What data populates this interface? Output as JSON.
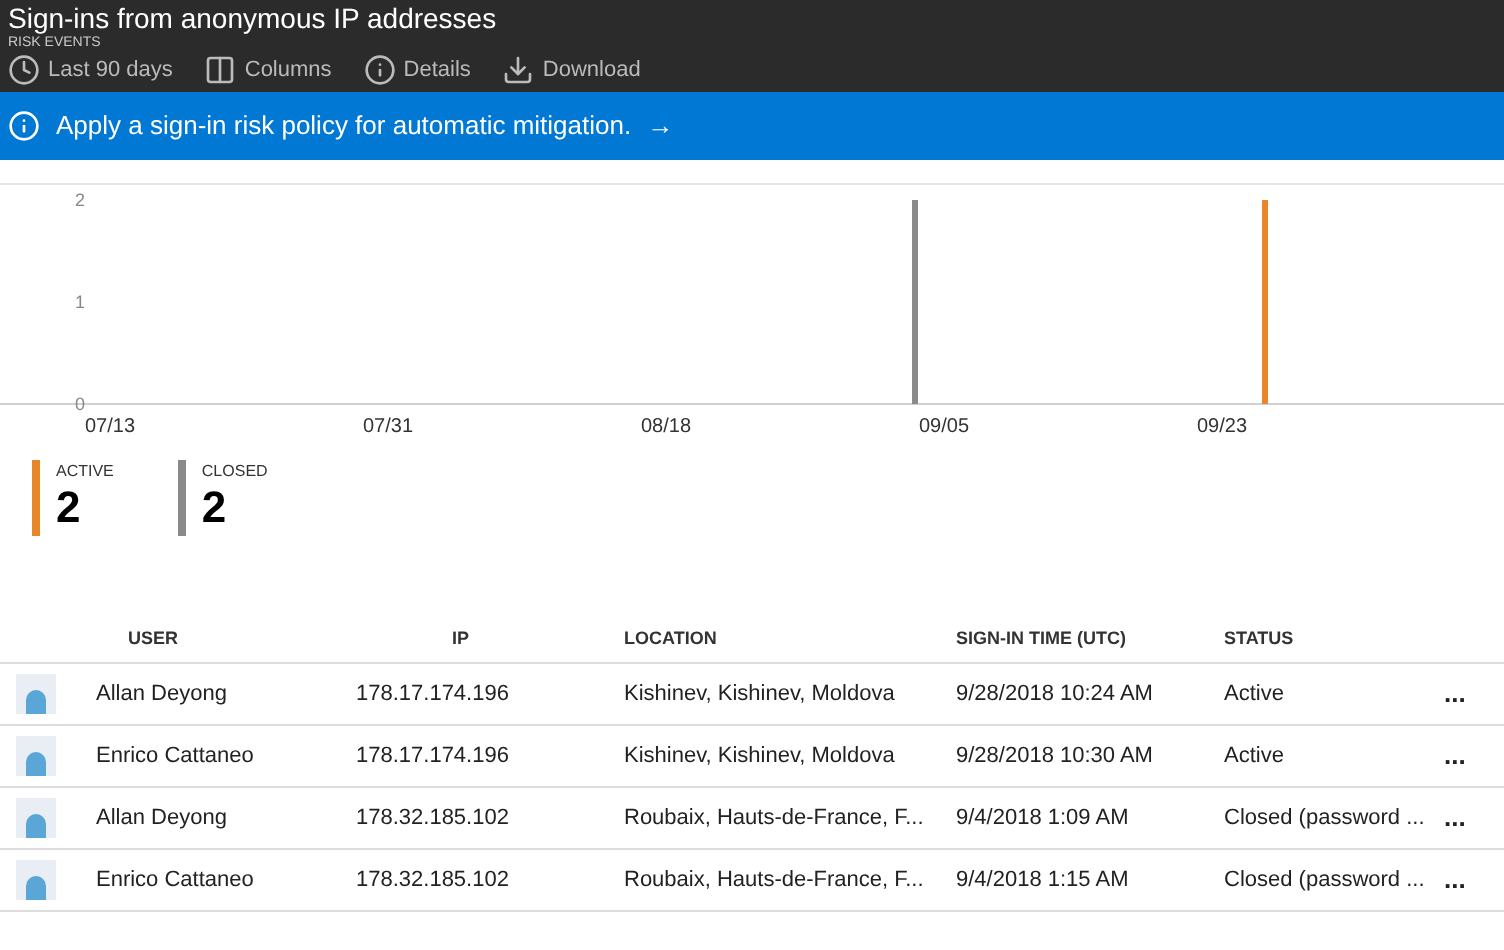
{
  "header": {
    "title": "Sign-ins from anonymous IP addresses",
    "subtitle": "RISK EVENTS"
  },
  "toolbar": [
    {
      "kind": "clock",
      "label": "Last 90 days"
    },
    {
      "kind": "columns",
      "label": "Columns"
    },
    {
      "kind": "info",
      "label": "Details"
    },
    {
      "kind": "download",
      "label": "Download"
    }
  ],
  "banner": {
    "text": "Apply a sign-in risk policy for automatic mitigation.",
    "arrow": "→"
  },
  "chart": {
    "chart_data": {
      "type": "bar",
      "categories": [
        "07/13",
        "07/31",
        "08/18",
        "09/05",
        "09/23"
      ],
      "series": [
        {
          "name": "ACTIVE",
          "color": "#e8872a",
          "values": [
            null,
            null,
            null,
            null,
            2
          ]
        },
        {
          "name": "CLOSED",
          "color": "#8a8a8a",
          "values": [
            null,
            null,
            null,
            2,
            null
          ]
        }
      ],
      "ylim": [
        0,
        2
      ],
      "yticks": [
        0,
        1,
        2
      ]
    }
  },
  "legend": [
    {
      "count": "2"
    },
    {
      "count": "2"
    }
  ],
  "table": {
    "columns": [
      "USER",
      "IP",
      "LOCATION",
      "SIGN-IN TIME (UTC)",
      "STATUS"
    ],
    "rows": [
      {
        "user": "Allan Deyong",
        "ip": "178.17.174.196",
        "location": "Kishinev, Kishinev, Moldova",
        "time": "9/28/2018 10:24 AM",
        "status": "Active",
        "menu": "..."
      },
      {
        "user": "Enrico Cattaneo",
        "ip": "178.17.174.196",
        "location": "Kishinev, Kishinev, Moldova",
        "time": "9/28/2018 10:30 AM",
        "status": "Active",
        "menu": "..."
      },
      {
        "user": "Allan Deyong",
        "ip": "178.32.185.102",
        "location": "Roubaix, Hauts-de-France, F...",
        "time": "9/4/2018 1:09 AM",
        "status": "Closed (password ...",
        "menu": "..."
      },
      {
        "user": "Enrico Cattaneo",
        "ip": "178.32.185.102",
        "location": "Roubaix, Hauts-de-France, F...",
        "time": "9/4/2018 1:15 AM",
        "status": "Closed (password ...",
        "menu": "..."
      }
    ]
  }
}
